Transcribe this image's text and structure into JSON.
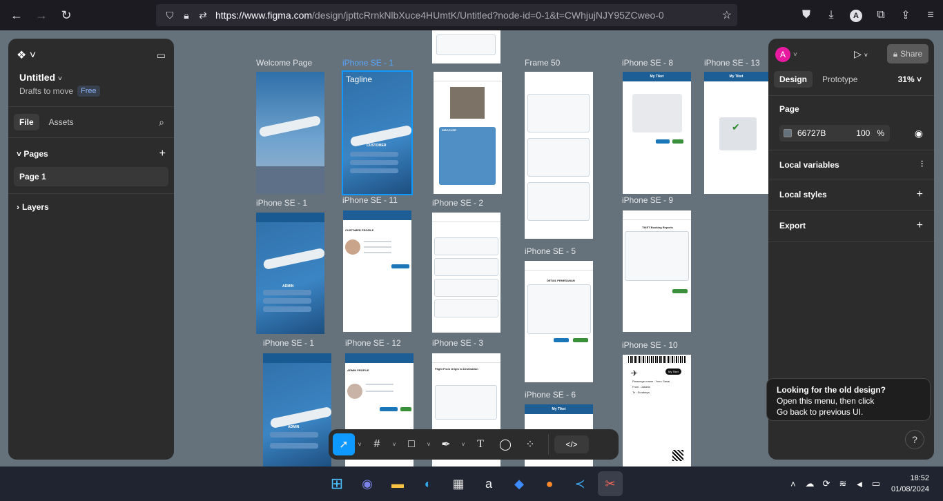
{
  "browser": {
    "url": "https://www.figma.com",
    "url_rest": "/design/jpttcRrnkNlbXuce4HUmtK/Untitled?node-id=0-1&t=CWhjujNJY95ZCweo-0",
    "account_initial": "A"
  },
  "left_panel": {
    "file_title": "Untitled",
    "file_location": "Drafts to move",
    "plan_badge": "Free",
    "tabs": [
      "File",
      "Assets"
    ],
    "pages_label": "Pages",
    "pages": [
      "Page 1"
    ],
    "layers_label": "Layers"
  },
  "right_panel": {
    "user_initial": "A",
    "share_label": "Share",
    "tabs": [
      "Design",
      "Prototype"
    ],
    "zoom": "31%",
    "page_section": "Page",
    "page_color": "66727B",
    "page_opacity": "100",
    "percent": "%",
    "sections": [
      "Local variables",
      "Local styles",
      "Export"
    ]
  },
  "tooltip": {
    "title": "Looking for the old design?",
    "line1": "Open this menu, then click",
    "line2": "Go back to previous UI."
  },
  "help_label": "?",
  "canvas": {
    "frames": [
      {
        "label": "Welcome Page"
      },
      {
        "label": "iPhone SE - 1"
      },
      {
        "label": "Frame 50"
      },
      {
        "label": "iPhone SE - 8"
      },
      {
        "label": "iPhone SE - 13"
      },
      {
        "label": "iPhone SE - 1"
      },
      {
        "label": "iPhone SE - 11"
      },
      {
        "label": "iPhone SE - 2"
      },
      {
        "label": "iPhone SE - 9"
      },
      {
        "label": "iPhone SE - 5"
      },
      {
        "label": "iPhone SE - 1"
      },
      {
        "label": "iPhone SE - 12"
      },
      {
        "label": "iPhone SE - 3"
      },
      {
        "label": "iPhone SE - 10"
      },
      {
        "label": "iPhone SE - 6"
      }
    ],
    "texts": {
      "tagline": "Tagline",
      "customer": "CUSTOMER",
      "admin": "ADMIN",
      "customer_profile": "CUSTOMER PROFILE",
      "admin_profile": "ADMIN PROFILE",
      "my_tiket": "My Tiket",
      "tiket_booking": "TIKET Booking Reports",
      "detail": "DETAIL PEMESANAN",
      "passenger": "Passenger name : Yuno Gasai",
      "from": "From : Jakarta",
      "to": "To : Surabaya",
      "my_tiket_badge": "My Tiket",
      "flight_from": "Flight From Origin to Destination",
      "discover": "DISCOVER"
    }
  },
  "toolbar": {
    "code_label": "</>"
  },
  "taskbar": {
    "time": "18:52",
    "date": "01/08/2024"
  }
}
